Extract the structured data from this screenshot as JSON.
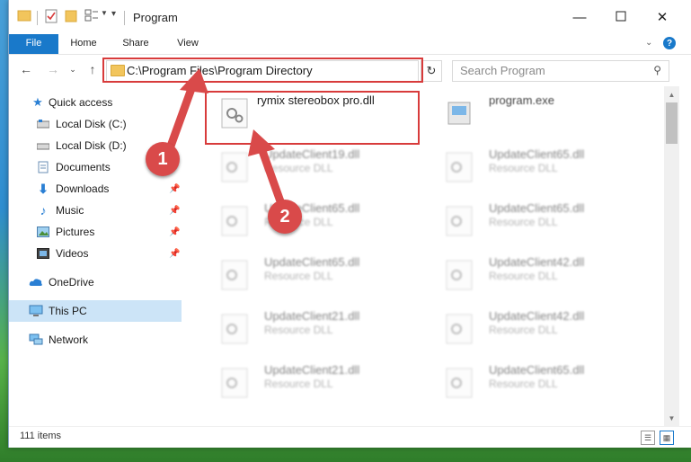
{
  "window": {
    "title": "Program",
    "minimize_icon": "minimize-icon",
    "maximize_icon": "maximize-icon",
    "close_icon": "close-icon"
  },
  "ribbon": {
    "tabs": [
      "File",
      "Home",
      "Share",
      "View"
    ]
  },
  "address": {
    "path": "C:\\Program Files\\Program Directory",
    "search_placeholder": "Search Program"
  },
  "sidebar": {
    "items": [
      {
        "label": "Quick access",
        "icon": "star-icon"
      },
      {
        "label": "Local Disk (C:)",
        "icon": "drive-icon"
      },
      {
        "label": "Local Disk (D:)",
        "icon": "drive-icon"
      },
      {
        "label": "Documents",
        "icon": "documents-icon"
      },
      {
        "label": "Downloads",
        "icon": "download-icon"
      },
      {
        "label": "Music",
        "icon": "music-icon"
      },
      {
        "label": "Pictures",
        "icon": "pictures-icon"
      },
      {
        "label": "Videos",
        "icon": "videos-icon"
      },
      {
        "label": "OneDrive",
        "icon": "cloud-icon"
      },
      {
        "label": "This PC",
        "icon": "computer-icon"
      },
      {
        "label": "Network",
        "icon": "network-icon"
      }
    ]
  },
  "files": [
    {
      "name": "rymix stereobox pro.dll",
      "type": ""
    },
    {
      "name": "program.exe",
      "type": ""
    },
    {
      "name": "UpdateClient19.dll",
      "type": "Resource DLL"
    },
    {
      "name": "UpdateClient65.dll",
      "type": "Resource DLL"
    },
    {
      "name": "UpdateClient65.dll",
      "type": "Resource DLL"
    },
    {
      "name": "UpdateClient65.dll",
      "type": "Resource DLL"
    },
    {
      "name": "UpdateClient65.dll",
      "type": "Resource DLL"
    },
    {
      "name": "UpdateClient42.dll",
      "type": "Resource DLL"
    },
    {
      "name": "UpdateClient21.dll",
      "type": "Resource DLL"
    },
    {
      "name": "UpdateClient42.dll",
      "type": "Resource DLL"
    },
    {
      "name": "UpdateClient21.dll",
      "type": "Resource DLL"
    },
    {
      "name": "UpdateClient65.dll",
      "type": "Resource DLL"
    }
  ],
  "status": {
    "items_count": "111 items"
  },
  "callouts": [
    "1",
    "2"
  ],
  "colors": {
    "accent": "#1979ca",
    "highlight": "#d83b3b",
    "selected": "#cce4f7"
  }
}
